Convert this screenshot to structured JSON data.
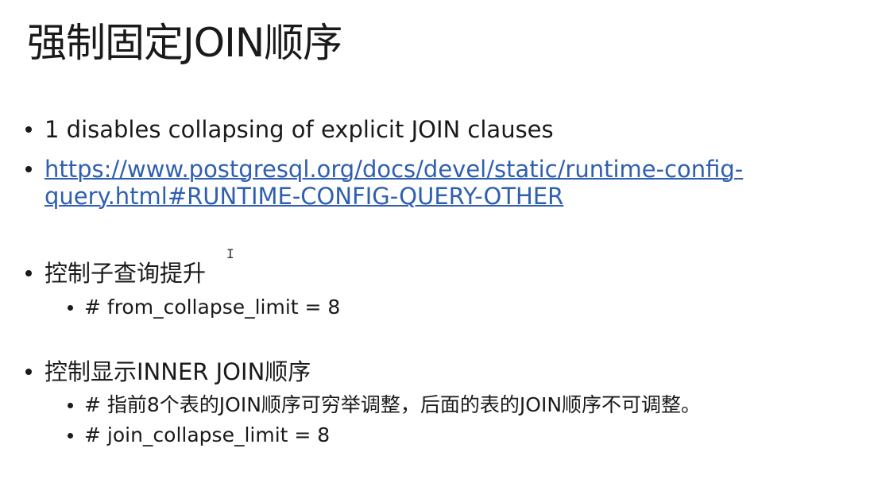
{
  "slide": {
    "title": "强制固定JOIN顺序",
    "bullets": [
      {
        "text": "1 disables collapsing of explicit JOIN clauses"
      },
      {
        "link_line1": "https://www.postgresql.org/docs/devel/static/runtime-config-",
        "link_line2": "query.html#RUNTIME-CONFIG-QUERY-OTHER"
      },
      {
        "text": "控制子查询提升",
        "sub": [
          "# from_collapse_limit = 8"
        ]
      },
      {
        "text": "控制显示INNER JOIN顺序",
        "sub": [
          "# 指前8个表的JOIN顺序可穷举调整，后面的表的JOIN顺序不可调整。",
          "# join_collapse_limit = 8"
        ]
      }
    ]
  },
  "cursor": {
    "glyph": "I"
  }
}
